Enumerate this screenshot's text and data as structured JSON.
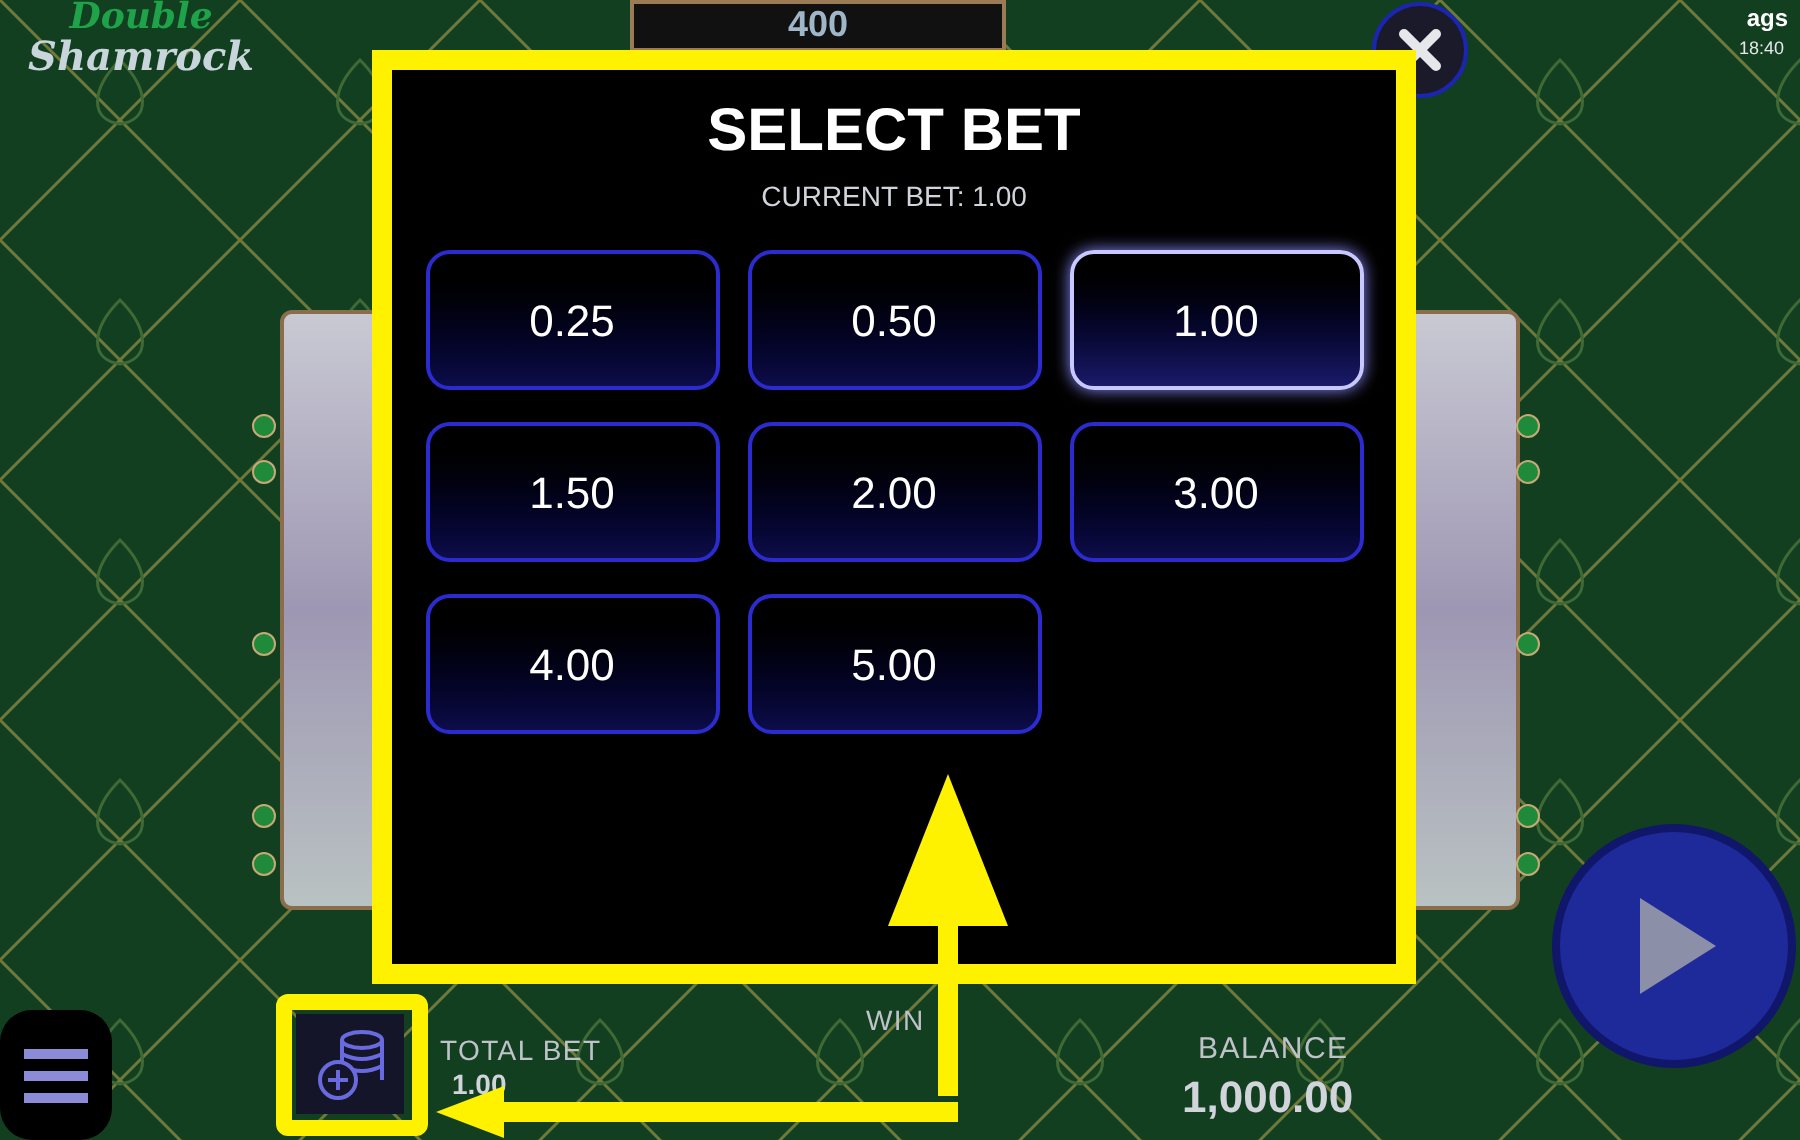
{
  "logo": {
    "line_1": "Double",
    "line_2": "Shamrock"
  },
  "brand": "ags",
  "clock": "18:40",
  "top_display": "400",
  "dialog": {
    "title": "SELECT BET",
    "current_bet": "CURRENT BET: 1.00",
    "bets": [
      {
        "label": "0.25",
        "selected": false
      },
      {
        "label": "0.50",
        "selected": false
      },
      {
        "label": "1.00",
        "selected": true
      },
      {
        "label": "1.50",
        "selected": false
      },
      {
        "label": "2.00",
        "selected": false
      },
      {
        "label": "3.00",
        "selected": false
      },
      {
        "label": "4.00",
        "selected": false
      },
      {
        "label": "5.00",
        "selected": false
      }
    ]
  },
  "footer": {
    "total_bet_label": "TOTAL BET",
    "total_bet_value": "1.00",
    "win_label": "WIN",
    "balance_label": "BALANCE",
    "balance_value": "1,000.00"
  }
}
